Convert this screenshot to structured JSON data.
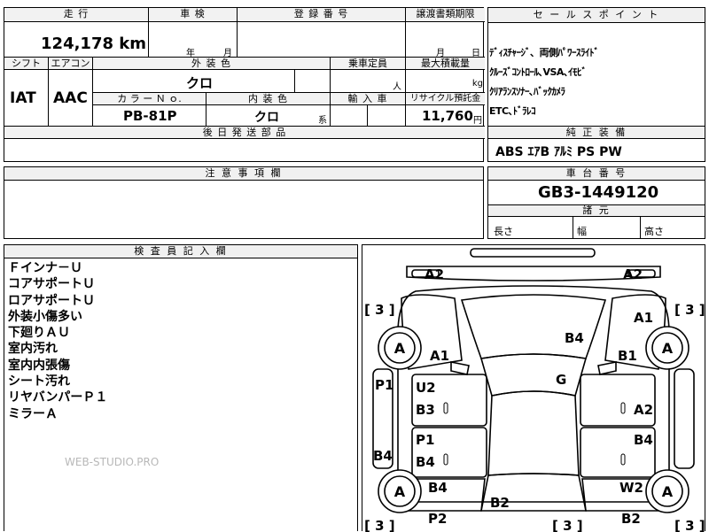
{
  "header": {
    "mileage_label": "走 行",
    "mileage_value": "124,178 km",
    "shaken_label": "車 検",
    "shaken_year": "年",
    "shaken_month": "月",
    "registration_label": "登 録 番 号",
    "transfer_label": "譲渡書類期限",
    "transfer_month": "月",
    "transfer_day": "日",
    "shift_label": "シフト",
    "shift_value": "IAT",
    "aircon_label": "エアコン",
    "aircon_value": "AAC",
    "exterior_label": "外 装 色",
    "exterior_value": "クロ",
    "capacity_label": "乗車定員",
    "capacity_unit": "人",
    "max_load_label": "最大積載量",
    "max_load_unit": "kg",
    "color_no_label": "カ ラ ー Ｎ ｏ.",
    "color_no_value": "PB-81P",
    "interior_label": "内 装 色",
    "interior_value": "クロ",
    "interior_suffix": "系",
    "import_label": "輸 入 車",
    "recycle_label": "リサイクル預託金",
    "recycle_value": "11,760",
    "recycle_unit": "円",
    "later_parts_label": "後 日 発 送 部 品"
  },
  "sales": {
    "title": "セ ー ル ス ポ イ ン ト",
    "lines": [
      "ﾃﾞｨｽﾁｬｰｼﾞ、両側ﾊﾟﾜｰｽﾗｲﾄﾞ",
      "ｸﾙｰｽﾞｺﾝﾄﾛｰﾙ､VSA､ｲﾓﾋﾞ",
      "ｸﾘｱﾗﾝｽｿﾅｰ､ﾊﾞｯｸｶﾒﾗ",
      "ETC､ﾄﾞﾗﾚｺ"
    ],
    "equip_title": "純 正 装 備",
    "equip_value": "ABS ｴｱB ｱﾙﾐ PS PW"
  },
  "notes": {
    "title": "注 意 事 項 欄"
  },
  "chassis": {
    "title": "車 台 番 号",
    "value": "GB3-1449120",
    "dims_title": "諸 元",
    "length": "長さ",
    "width": "幅",
    "height": "高さ"
  },
  "inspector": {
    "title": "検 査 員 記 入 欄",
    "lines": [
      "Ｆインナ－Ｕ",
      "コアサポートＵ",
      "ロアサポートＵ",
      "外装小傷多い",
      "下廻りＡＵ",
      "室内汚れ",
      "室内内張傷",
      "シート汚れ",
      "リヤバンパーＰ１",
      "ミラーＡ"
    ],
    "watermark": "WEB-STUDIO.PRO"
  },
  "diagram": {
    "marks": {
      "a2_left": "A2",
      "a2_right": "A2",
      "a1_right": "A1",
      "b4_hood": "B4",
      "a1_left": "A1",
      "b1_right": "B1",
      "g_glass": "G",
      "p1_left": "P1",
      "u2": "U2",
      "b3": "B3",
      "a2_door_right": "A2",
      "p1_mid": "P1",
      "b4_mid": "B4",
      "b4_door_right": "B4",
      "b4_rocker_left": "B4",
      "b4_rear_left": "B4",
      "w2": "W2",
      "b2_rear": "B2",
      "p2": "P2",
      "b2_right": "B2"
    },
    "tires": [
      "A",
      "A",
      "A",
      "A"
    ],
    "bracket_values": [
      "3",
      "3",
      "3",
      "3",
      "3"
    ]
  }
}
